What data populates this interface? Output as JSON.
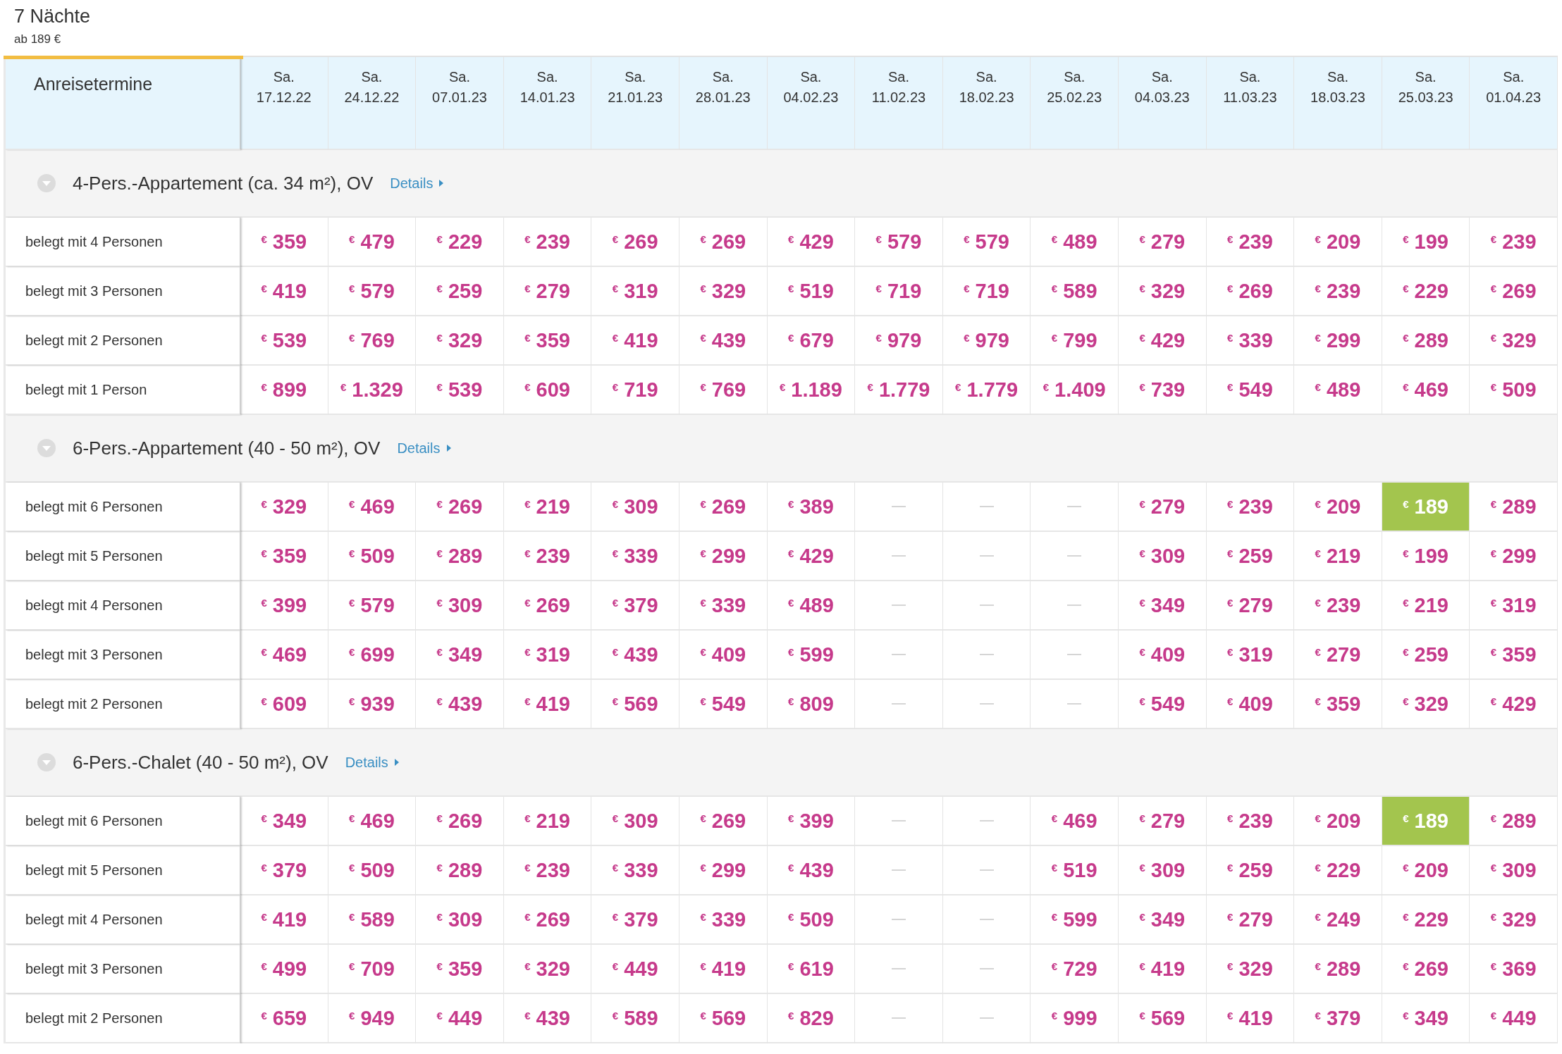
{
  "tab": {
    "title": "7 Nächte",
    "subtitle": "ab 189 €",
    "selected": true
  },
  "table": {
    "corner": "Anreisetermine",
    "columns": [
      {
        "day": "Sa.",
        "date": "17.12.22"
      },
      {
        "day": "Sa.",
        "date": "24.12.22"
      },
      {
        "day": "Sa.",
        "date": "07.01.23"
      },
      {
        "day": "Sa.",
        "date": "14.01.23"
      },
      {
        "day": "Sa.",
        "date": "21.01.23"
      },
      {
        "day": "Sa.",
        "date": "28.01.23"
      },
      {
        "day": "Sa.",
        "date": "04.02.23"
      },
      {
        "day": "Sa.",
        "date": "11.02.23"
      },
      {
        "day": "Sa.",
        "date": "18.02.23"
      },
      {
        "day": "Sa.",
        "date": "25.02.23"
      },
      {
        "day": "Sa.",
        "date": "04.03.23"
      },
      {
        "day": "Sa.",
        "date": "11.03.23"
      },
      {
        "day": "Sa.",
        "date": "18.03.23"
      },
      {
        "day": "Sa.",
        "date": "25.03.23"
      },
      {
        "day": "Sa.",
        "date": "01.04.23"
      }
    ],
    "groups": [
      {
        "title": "4-Pers.-Appartement (ca. 34 m²), OV",
        "link": "Details",
        "expanded": true,
        "rows": [
          {
            "label": "belegt mit 4 Personen",
            "cells": [
              {
                "price": "$^{€}$ 359",
                "best": false
              },
              {
                "price": "$^{€}$ 479",
                "best": false
              },
              {
                "price": "$^{€}$ 229",
                "best": false
              },
              {
                "price": "$^{€}$ 239",
                "best": false
              },
              {
                "price": "$^{€}$ 269",
                "best": false
              },
              {
                "price": "$^{€}$ 269",
                "best": false
              },
              {
                "price": "$^{€}$ 429",
                "best": false
              },
              {
                "price": "$^{€}$ 579",
                "best": false
              },
              {
                "price": "$^{€}$ 579",
                "best": false
              },
              {
                "price": "$^{€}$ 489",
                "best": false
              },
              {
                "price": "$^{€}$ 279",
                "best": false
              },
              {
                "price": "$^{€}$ 239",
                "best": false
              },
              {
                "price": "$^{€}$ 209",
                "best": false
              },
              {
                "price": "$^{€}$ 199",
                "best": false
              },
              {
                "price": "$^{€}$ 239",
                "best": false
              }
            ]
          },
          {
            "label": "belegt mit 3 Personen",
            "cells": [
              {
                "price": "$^{€}$ 419",
                "best": false
              },
              {
                "price": "$^{€}$ 579",
                "best": false
              },
              {
                "price": "$^{€}$ 259",
                "best": false
              },
              {
                "price": "$^{€}$ 279",
                "best": false
              },
              {
                "price": "$^{€}$ 319",
                "best": false
              },
              {
                "price": "$^{€}$ 329",
                "best": false
              },
              {
                "price": "$^{€}$ 519",
                "best": false
              },
              {
                "price": "$^{€}$ 719",
                "best": false
              },
              {
                "price": "$^{€}$ 719",
                "best": false
              },
              {
                "price": "$^{€}$ 589",
                "best": false
              },
              {
                "price": "$^{€}$ 329",
                "best": false
              },
              {
                "price": "$^{€}$ 269",
                "best": false
              },
              {
                "price": "$^{€}$ 239",
                "best": false
              },
              {
                "price": "$^{€}$ 229",
                "best": false
              },
              {
                "price": "$^{€}$ 269",
                "best": false
              }
            ]
          },
          {
            "label": "belegt mit 2 Personen",
            "cells": [
              {
                "price": "$^{€}$ 539",
                "best": false
              },
              {
                "price": "$^{€}$ 769",
                "best": false
              },
              {
                "price": "$^{€}$ 329",
                "best": false
              },
              {
                "price": "$^{€}$ 359",
                "best": false
              },
              {
                "price": "$^{€}$ 419",
                "best": false
              },
              {
                "price": "$^{€}$ 439",
                "best": false
              },
              {
                "price": "$^{€}$ 679",
                "best": false
              },
              {
                "price": "$^{€}$ 979",
                "best": false
              },
              {
                "price": "$^{€}$ 979",
                "best": false
              },
              {
                "price": "$^{€}$ 799",
                "best": false
              },
              {
                "price": "$^{€}$ 429",
                "best": false
              },
              {
                "price": "$^{€}$ 339",
                "best": false
              },
              {
                "price": "$^{€}$ 299",
                "best": false
              },
              {
                "price": "$^{€}$ 289",
                "best": false
              },
              {
                "price": "$^{€}$ 329",
                "best": false
              }
            ]
          },
          {
            "label": "belegt mit 1 Person",
            "cells": [
              {
                "price": "$^{€}$ 899",
                "best": false
              },
              {
                "price": "$^{€}$ 1.329",
                "best": false
              },
              {
                "price": "$^{€}$ 539",
                "best": false
              },
              {
                "price": "$^{€}$ 609",
                "best": false
              },
              {
                "price": "$^{€}$ 719",
                "best": false
              },
              {
                "price": "$^{€}$ 769",
                "best": false
              },
              {
                "price": "$^{€}$ 1.189",
                "best": false
              },
              {
                "price": "$^{€}$ 1.779",
                "best": false
              },
              {
                "price": "$^{€}$ 1.779",
                "best": false
              },
              {
                "price": "$^{€}$ 1.409",
                "best": false
              },
              {
                "price": "$^{€}$ 739",
                "best": false
              },
              {
                "price": "$^{€}$ 549",
                "best": false
              },
              {
                "price": "$^{€}$ 489",
                "best": false
              },
              {
                "price": "$^{€}$ 469",
                "best": false
              },
              {
                "price": "$^{€}$ 509",
                "best": false
              }
            ]
          }
        ]
      },
      {
        "title": "6-Pers.-Appartement (40 - 50 m²), OV",
        "link": "Details",
        "expanded": true,
        "rows": [
          {
            "label": "belegt mit 6 Personen",
            "cells": [
              {
                "price": "$^{€}$ 329",
                "best": false
              },
              {
                "price": "$^{€}$ 469",
                "best": false
              },
              {
                "price": "$^{€}$ 269",
                "best": false
              },
              {
                "price": "$^{€}$ 219",
                "best": false
              },
              {
                "price": "$^{€}$ 309",
                "best": false
              },
              {
                "price": "$^{€}$ 269",
                "best": false
              },
              {
                "price": "$^{€}$ 389",
                "best": false
              },
              null,
              null,
              null,
              {
                "price": "$^{€}$ 279",
                "best": false
              },
              {
                "price": "$^{€}$ 239",
                "best": false
              },
              {
                "price": "$^{€}$ 209",
                "best": false
              },
              {
                "price": "$^{€}$ 189",
                "best": true
              },
              {
                "price": "$^{€}$ 289",
                "best": false
              }
            ]
          },
          {
            "label": "belegt mit 5 Personen",
            "cells": [
              {
                "price": "$^{€}$ 359",
                "best": false
              },
              {
                "price": "$^{€}$ 509",
                "best": false
              },
              {
                "price": "$^{€}$ 289",
                "best": false
              },
              {
                "price": "$^{€}$ 239",
                "best": false
              },
              {
                "price": "$^{€}$ 339",
                "best": false
              },
              {
                "price": "$^{€}$ 299",
                "best": false
              },
              {
                "price": "$^{€}$ 429",
                "best": false
              },
              null,
              null,
              null,
              {
                "price": "$^{€}$ 309",
                "best": false
              },
              {
                "price": "$^{€}$ 259",
                "best": false
              },
              {
                "price": "$^{€}$ 219",
                "best": false
              },
              {
                "price": "$^{€}$ 199",
                "best": false
              },
              {
                "price": "$^{€}$ 299",
                "best": false
              }
            ]
          },
          {
            "label": "belegt mit 4 Personen",
            "cells": [
              {
                "price": "$^{€}$ 399",
                "best": false
              },
              {
                "price": "$^{€}$ 579",
                "best": false
              },
              {
                "price": "$^{€}$ 309",
                "best": false
              },
              {
                "price": "$^{€}$ 269",
                "best": false
              },
              {
                "price": "$^{€}$ 379",
                "best": false
              },
              {
                "price": "$^{€}$ 339",
                "best": false
              },
              {
                "price": "$^{€}$ 489",
                "best": false
              },
              null,
              null,
              null,
              {
                "price": "$^{€}$ 349",
                "best": false
              },
              {
                "price": "$^{€}$ 279",
                "best": false
              },
              {
                "price": "$^{€}$ 239",
                "best": false
              },
              {
                "price": "$^{€}$ 219",
                "best": false
              },
              {
                "price": "$^{€}$ 319",
                "best": false
              }
            ]
          },
          {
            "label": "belegt mit 3 Personen",
            "cells": [
              {
                "price": "$^{€}$ 469",
                "best": false
              },
              {
                "price": "$^{€}$ 699",
                "best": false
              },
              {
                "price": "$^{€}$ 349",
                "best": false
              },
              {
                "price": "$^{€}$ 319",
                "best": false
              },
              {
                "price": "$^{€}$ 439",
                "best": false
              },
              {
                "price": "$^{€}$ 409",
                "best": false
              },
              {
                "price": "$^{€}$ 599",
                "best": false
              },
              null,
              null,
              null,
              {
                "price": "$^{€}$ 409",
                "best": false
              },
              {
                "price": "$^{€}$ 319",
                "best": false
              },
              {
                "price": "$^{€}$ 279",
                "best": false
              },
              {
                "price": "$^{€}$ 259",
                "best": false
              },
              {
                "price": "$^{€}$ 359",
                "best": false
              }
            ]
          },
          {
            "label": "belegt mit 2 Personen",
            "cells": [
              {
                "price": "$^{€}$ 609",
                "best": false
              },
              {
                "price": "$^{€}$ 939",
                "best": false
              },
              {
                "price": "$^{€}$ 439",
                "best": false
              },
              {
                "price": "$^{€}$ 419",
                "best": false
              },
              {
                "price": "$^{€}$ 569",
                "best": false
              },
              {
                "price": "$^{€}$ 549",
                "best": false
              },
              {
                "price": "$^{€}$ 809",
                "best": false
              },
              null,
              null,
              null,
              {
                "price": "$^{€}$ 549",
                "best": false
              },
              {
                "price": "$^{€}$ 409",
                "best": false
              },
              {
                "price": "$^{€}$ 359",
                "best": false
              },
              {
                "price": "$^{€}$ 329",
                "best": false
              },
              {
                "price": "$^{€}$ 429",
                "best": false
              }
            ]
          }
        ]
      },
      {
        "title": "6-Pers.-Chalet (40 - 50 m²), OV",
        "link": "Details",
        "expanded": true,
        "rows": [
          {
            "label": "belegt mit 6 Personen",
            "cells": [
              {
                "price": "$^{€}$ 349",
                "best": false
              },
              {
                "price": "$^{€}$ 469",
                "best": false
              },
              {
                "price": "$^{€}$ 269",
                "best": false
              },
              {
                "price": "$^{€}$ 219",
                "best": false
              },
              {
                "price": "$^{€}$ 309",
                "best": false
              },
              {
                "price": "$^{€}$ 269",
                "best": false
              },
              {
                "price": "$^{€}$ 399",
                "best": false
              },
              null,
              null,
              {
                "price": "$^{€}$ 469",
                "best": false
              },
              {
                "price": "$^{€}$ 279",
                "best": false
              },
              {
                "price": "$^{€}$ 239",
                "best": false
              },
              {
                "price": "$^{€}$ 209",
                "best": false
              },
              {
                "price": "$^{€}$ 189",
                "best": true
              },
              {
                "price": "$^{€}$ 289",
                "best": false
              }
            ]
          },
          {
            "label": "belegt mit 5 Personen",
            "cells": [
              {
                "price": "$^{€}$ 379",
                "best": false
              },
              {
                "price": "$^{€}$ 509",
                "best": false
              },
              {
                "price": "$^{€}$ 289",
                "best": false
              },
              {
                "price": "$^{€}$ 239",
                "best": false
              },
              {
                "price": "$^{€}$ 339",
                "best": false
              },
              {
                "price": "$^{€}$ 299",
                "best": false
              },
              {
                "price": "$^{€}$ 439",
                "best": false
              },
              null,
              null,
              {
                "price": "$^{€}$ 519",
                "best": false
              },
              {
                "price": "$^{€}$ 309",
                "best": false
              },
              {
                "price": "$^{€}$ 259",
                "best": false
              },
              {
                "price": "$^{€}$ 229",
                "best": false
              },
              {
                "price": "$^{€}$ 209",
                "best": false
              },
              {
                "price": "$^{€}$ 309",
                "best": false
              }
            ]
          },
          {
            "label": "belegt mit 4 Personen",
            "cells": [
              {
                "price": "$^{€}$ 419",
                "best": false
              },
              {
                "price": "$^{€}$ 589",
                "best": false
              },
              {
                "price": "$^{€}$ 309",
                "best": false
              },
              {
                "price": "$^{€}$ 269",
                "best": false
              },
              {
                "price": "$^{€}$ 379",
                "best": false
              },
              {
                "price": "$^{€}$ 339",
                "best": false
              },
              {
                "price": "$^{€}$ 509",
                "best": false
              },
              null,
              null,
              {
                "price": "$^{€}$ 599",
                "best": false
              },
              {
                "price": "$^{€}$ 349",
                "best": false
              },
              {
                "price": "$^{€}$ 279",
                "best": false
              },
              {
                "price": "$^{€}$ 249",
                "best": false
              },
              {
                "price": "$^{€}$ 229",
                "best": false
              },
              {
                "price": "$^{€}$ 329",
                "best": false
              }
            ]
          },
          {
            "label": "belegt mit 3 Personen",
            "cells": [
              {
                "price": "$^{€}$ 499",
                "best": false
              },
              {
                "price": "$^{€}$ 709",
                "best": false
              },
              {
                "price": "$^{€}$ 359",
                "best": false
              },
              {
                "price": "$^{€}$ 329",
                "best": false
              },
              {
                "price": "$^{€}$ 449",
                "best": false
              },
              {
                "price": "$^{€}$ 419",
                "best": false
              },
              {
                "price": "$^{€}$ 619",
                "best": false
              },
              null,
              null,
              {
                "price": "$^{€}$ 729",
                "best": false
              },
              {
                "price": "$^{€}$ 419",
                "best": false
              },
              {
                "price": "$^{€}$ 329",
                "best": false
              },
              {
                "price": "$^{€}$ 289",
                "best": false
              },
              {
                "price": "$^{€}$ 269",
                "best": false
              },
              {
                "price": "$^{€}$ 369",
                "best": false
              }
            ]
          },
          {
            "label": "belegt mit 2 Personen",
            "cells": [
              {
                "price": "$^{€}$ 659",
                "best": false
              },
              {
                "price": "$^{€}$ 949",
                "best": false
              },
              {
                "price": "$^{€}$ 449",
                "best": false
              },
              {
                "price": "$^{€}$ 439",
                "best": false
              },
              {
                "price": "$^{€}$ 589",
                "best": false
              },
              {
                "price": "$^{€}$ 569",
                "best": false
              },
              {
                "price": "$^{€}$ 829",
                "best": false
              },
              null,
              null,
              {
                "price": "$^{€}$ 999",
                "best": false
              },
              {
                "price": "$^{€}$ 569",
                "best": false
              },
              {
                "price": "$^{€}$ 419",
                "best": false
              },
              {
                "price": "$^{€}$ 379",
                "best": false
              },
              {
                "price": "$^{€}$ 349",
                "best": false
              },
              {
                "price": "$^{€}$ 449",
                "best": false
              }
            ]
          }
        ]
      }
    ]
  }
}
